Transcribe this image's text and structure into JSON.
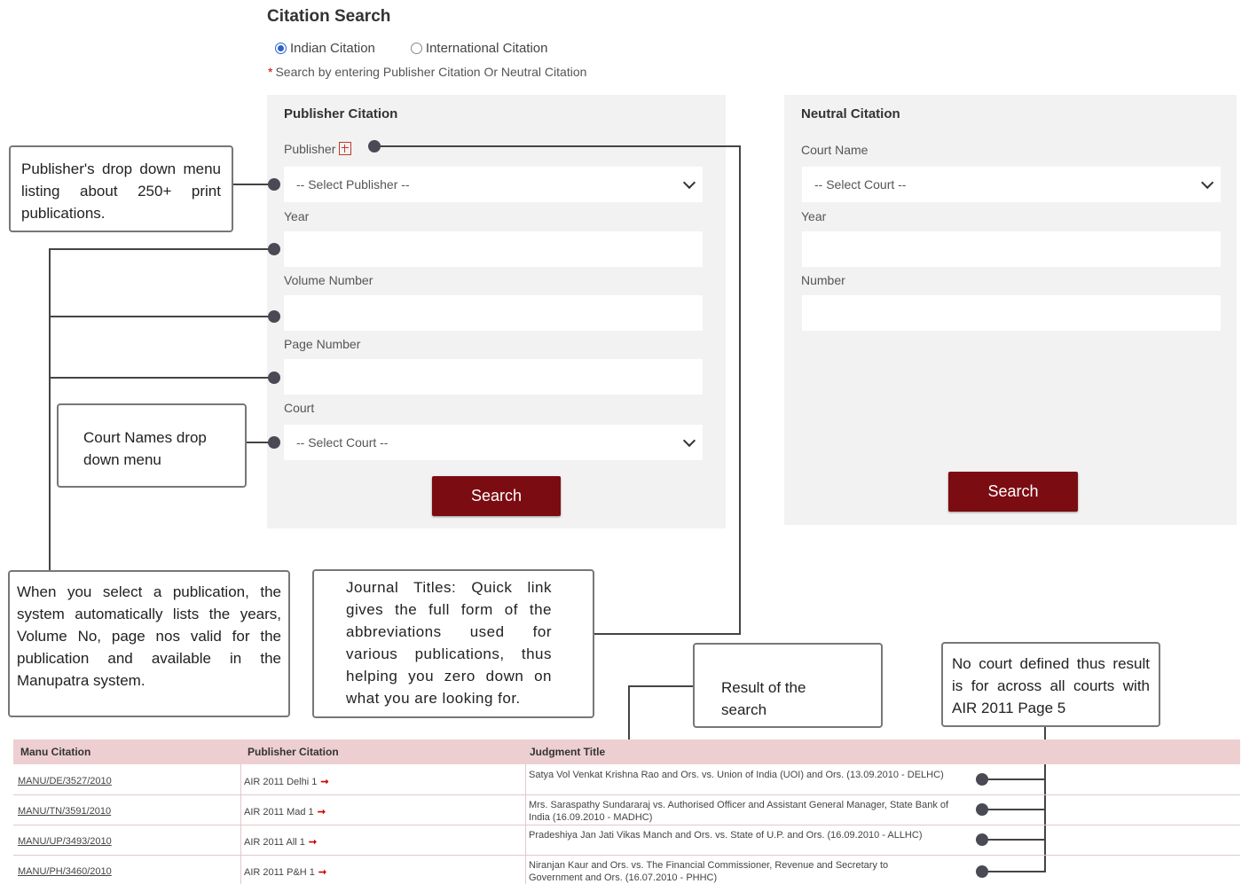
{
  "header": {
    "title": "Citation Search",
    "radio_indian": "Indian Citation",
    "radio_international": "International Citation",
    "hint_star": "*",
    "hint": "Search by entering Publisher Citation Or Neutral Citation"
  },
  "publisher_panel": {
    "heading": "Publisher Citation",
    "publisher_label": "Publisher",
    "publisher_select": "-- Select Publisher --",
    "year_label": "Year",
    "volume_label": "Volume Number",
    "page_label": "Page Number",
    "court_label": "Court",
    "court_select": "-- Select Court --",
    "search_button": "Search"
  },
  "neutral_panel": {
    "heading": "Neutral Citation",
    "court_name_label": "Court Name",
    "court_select": "-- Select Court --",
    "year_label": "Year",
    "number_label": "Number",
    "search_button": "Search"
  },
  "callouts": {
    "publisher_dropdown": "Publisher's drop down menu listing about 250+ print publications.",
    "court_names": "Court Names drop down menu",
    "auto_list": "When you select a publication, the system automatically lists the years, Volume No, page nos valid for the publication and available in the Manupatra system.",
    "journal_titles": "Journal Titles: Quick link gives the full form of the abbreviations used for various publications, thus helping you zero down on what you are looking for.",
    "result": "Result of the search",
    "no_court": "No court defined thus result is for across all courts with AIR 2011 Page 5"
  },
  "results": {
    "columns": [
      "Manu Citation",
      "Publisher Citation",
      "Judgment Title"
    ],
    "rows": [
      {
        "manu": "MANU/DE/3527/2010",
        "pub": "AIR 2011 Delhi 1",
        "title": "Satya Vol Venkat Krishna Rao and Ors. vs. Union of India (UOI) and Ors. (13.09.2010 - DELHC)"
      },
      {
        "manu": "MANU/TN/3591/2010",
        "pub": "AIR 2011 Mad 1",
        "title": "Mrs. Saraspathy Sundararaj vs. Authorised Officer and Assistant General Manager, State Bank of India (16.09.2010 - MADHC)"
      },
      {
        "manu": "MANU/UP/3493/2010",
        "pub": "AIR 2011 All 1",
        "title": "Pradeshiya Jan Jati Vikas Manch and Ors. vs. State of U.P. and Ors. (16.09.2010 - ALLHC)"
      },
      {
        "manu": "MANU/PH/3460/2010",
        "pub": "AIR 2011 P&H 1",
        "title": "Niranjan Kaur and Ors. vs. The Financial Commissioner, Revenue and Secretary to Government and Ors. (16.07.2010 - PHHC)"
      }
    ],
    "arrow_glyph": "➞"
  },
  "colors": {
    "accent": "#7b0c12",
    "panel_bg": "#f2f2f2",
    "table_header_bg": "#edcfd2"
  }
}
